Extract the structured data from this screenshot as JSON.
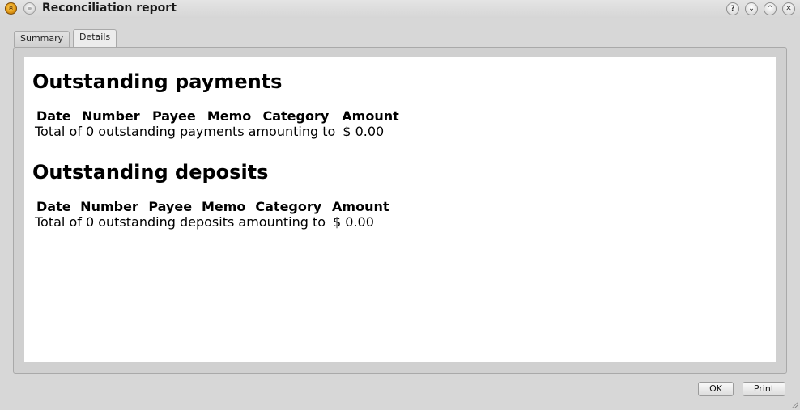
{
  "window": {
    "title": "Reconciliation report",
    "controls": {
      "help": "?",
      "minimize": "⌄",
      "maximize": "⌃",
      "close": "✕"
    }
  },
  "tabs": [
    {
      "label": "Summary",
      "selected": false
    },
    {
      "label": "Details",
      "selected": true
    }
  ],
  "sections": [
    {
      "heading": "Outstanding payments",
      "columns": [
        "Date",
        "Number",
        "Payee",
        "Memo",
        "Category",
        "Amount"
      ],
      "total_text": "Total of 0 outstanding payments amounting to",
      "total_amount": "$ 0.00"
    },
    {
      "heading": "Outstanding deposits",
      "columns": [
        "Date",
        "Number",
        "Payee",
        "Memo",
        "Category",
        "Amount"
      ],
      "total_text": "Total of 0 outstanding deposits amounting to",
      "total_amount": "$ 0.00"
    }
  ],
  "buttons": {
    "ok": "OK",
    "print": "Print"
  },
  "icons": {
    "app": "kmymoney-coin-icon",
    "menu": "window-menu-icon",
    "help": "help-icon",
    "minimize": "minimize-icon",
    "maximize": "maximize-icon",
    "close": "close-icon",
    "resize": "resize-grip-icon"
  },
  "colors": {
    "background": "#d7d7d7",
    "content": "#ffffff"
  }
}
